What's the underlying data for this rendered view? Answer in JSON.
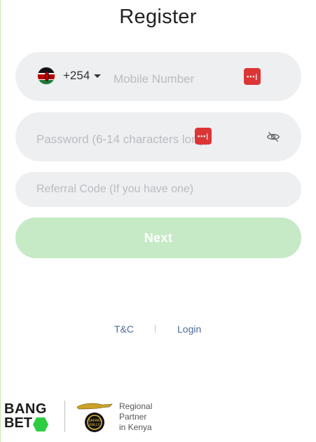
{
  "header": {
    "title": "Register"
  },
  "phone": {
    "country_flag": "kenya-flag-icon",
    "country_code": "+254",
    "placeholder": "Mobile Number",
    "autofill_icon": "password-manager-icon"
  },
  "password": {
    "placeholder": "Password (6-14 characters long)",
    "autofill_icon": "password-manager-icon",
    "visibility_icon": "eye-off-icon"
  },
  "referral": {
    "placeholder": "Referral Code (If you have one)"
  },
  "actions": {
    "next_label": "Next",
    "next_color": "#c6e9c6"
  },
  "links": {
    "terms": "T&C",
    "separator": "|",
    "login": "Login"
  },
  "footer": {
    "brand_line1": "BANG",
    "brand_line2": "BET",
    "partner_logo": "safari-rally-logo",
    "partner_text": [
      "Regional",
      "Partner",
      "in Kenya"
    ],
    "brand_accent": "#2ecc40"
  }
}
